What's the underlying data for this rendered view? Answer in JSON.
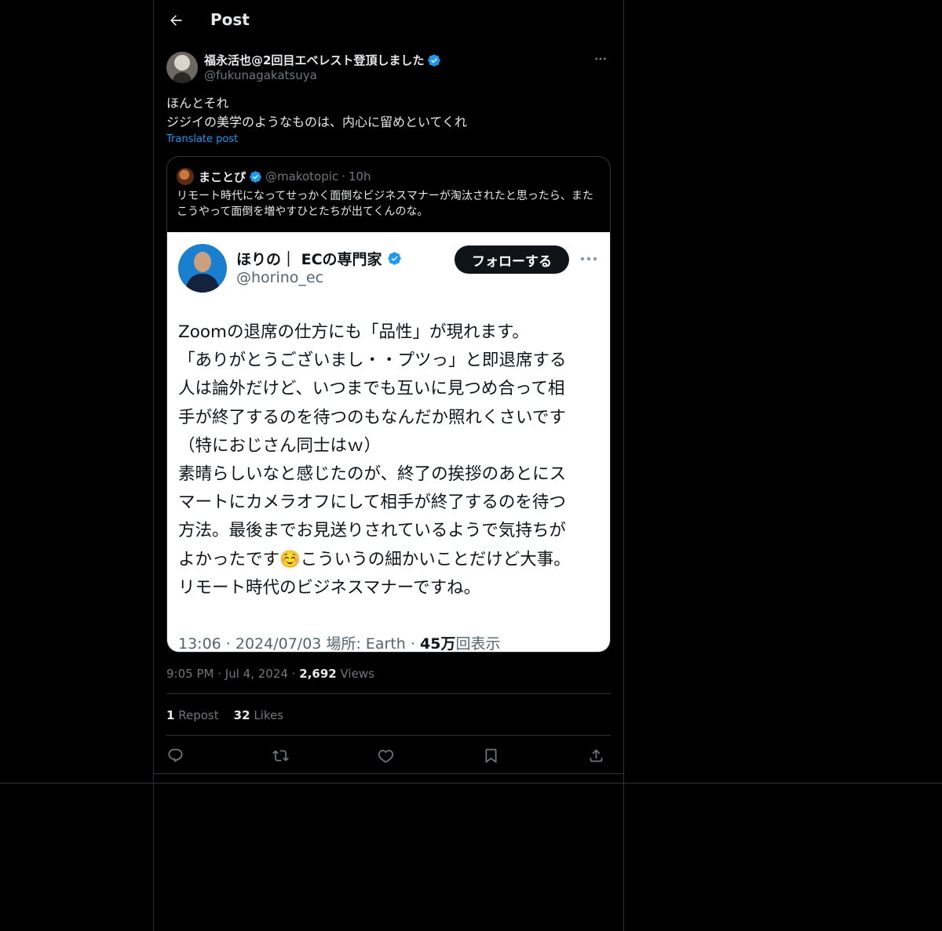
{
  "header": {
    "title": "Post"
  },
  "author": {
    "name": "福永活也@2回目エベレスト登頂しました",
    "handle": "@fukunagakatsuya",
    "verified": true
  },
  "post": {
    "text_line1": "ほんとそれ",
    "text_line2": "ジジイの美学のようなものは、内心に留めといてくれ",
    "translate_label": "Translate post"
  },
  "quote": {
    "name": "まことぴ",
    "handle": "@makotopic",
    "separator": "·",
    "time": "10h",
    "text": "リモート時代になってせっかく面倒なビジネスマナーが淘汰されたと思ったら、またこうやって面倒を増やすひとたちが出てくんのな。",
    "image": {
      "name": "ほりの｜ ECの専門家",
      "handle": "@horino_ec",
      "follow_label": "フォローする",
      "body": [
        "Zoomの退席の仕方にも「品性」が現れます。",
        "「ありがとうございまし・・プツっ」と即退席する",
        "人は論外だけど、いつまでも互いに見つめ合って相",
        "手が終了するのを待つのもなんだか照れくさいです",
        "（特におじさん同士はｗ）",
        "素晴らしいなと感じたのが、終了の挨拶のあとにス",
        "マートにカメラオフにして相手が終了するのを待つ",
        "方法。最後までお見送りされているようで気持ちが",
        "よかったです☺️こういうの細かいことだけど大事。",
        "リモート時代のビジネスマナーですね。"
      ],
      "meta_time": "13:06 · 2024/07/03",
      "meta_place": "場所: Earth",
      "meta_dot": "·",
      "meta_views_num": "45万",
      "meta_views_label": "回表示"
    }
  },
  "meta": {
    "time": "9:05 PM",
    "dot1": "·",
    "date": "Jul 4, 2024",
    "dot2": "·",
    "views_count": "2,692",
    "views_label": "Views"
  },
  "stats": {
    "reposts_count": "1",
    "reposts_label": "Repost",
    "likes_count": "32",
    "likes_label": "Likes"
  },
  "icons": {
    "back": "arrow-left-icon",
    "more": "more-horizontal-icon",
    "verified": "verified-badge-icon",
    "reply": "reply-icon",
    "repost": "repost-icon",
    "like": "heart-icon",
    "bookmark": "bookmark-icon",
    "share": "share-icon"
  },
  "colors": {
    "background": "#000000",
    "accent": "#1d9bf0",
    "text": "#e7e9ea",
    "muted": "#71767b",
    "divider": "#2f3336"
  }
}
